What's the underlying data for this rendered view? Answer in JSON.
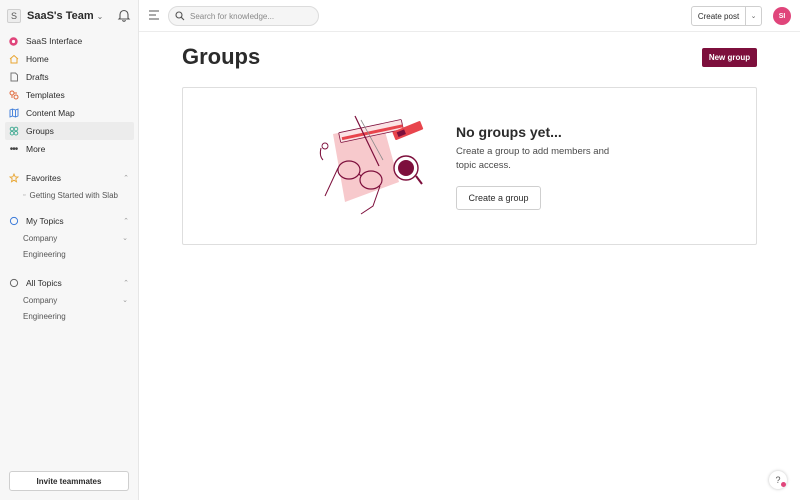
{
  "sidebar": {
    "team_initial": "S",
    "team_name": "SaaS's Team",
    "items": [
      {
        "label": "SaaS Interface",
        "icon": "brand-dot-icon"
      },
      {
        "label": "Home",
        "icon": "home-icon"
      },
      {
        "label": "Drafts",
        "icon": "draft-icon"
      },
      {
        "label": "Templates",
        "icon": "template-icon"
      },
      {
        "label": "Content Map",
        "icon": "map-icon"
      },
      {
        "label": "Groups",
        "icon": "groups-icon",
        "active": true
      },
      {
        "label": "More",
        "icon": "more-dots-icon"
      }
    ],
    "favorites": {
      "title": "Favorites",
      "items": [
        "Getting Started with Slab"
      ]
    },
    "my_topics": {
      "title": "My Topics",
      "items": [
        "Company",
        "Engineering"
      ]
    },
    "all_topics": {
      "title": "All Topics",
      "items": [
        "Company",
        "Engineering"
      ]
    },
    "invite_label": "Invite teammates"
  },
  "topbar": {
    "search_placeholder": "Search for knowledge...",
    "create_post_label": "Create post",
    "avatar_initials": "SI"
  },
  "main": {
    "title": "Groups",
    "new_group_label": "New group",
    "empty_title": "No groups yet...",
    "empty_desc": "Create a group to add members and topic access.",
    "create_group_label": "Create a group"
  },
  "help": {
    "label": "?"
  },
  "colors": {
    "accent": "#7d0f3c",
    "avatar": "#e0457b",
    "brand": "#e0457b"
  }
}
